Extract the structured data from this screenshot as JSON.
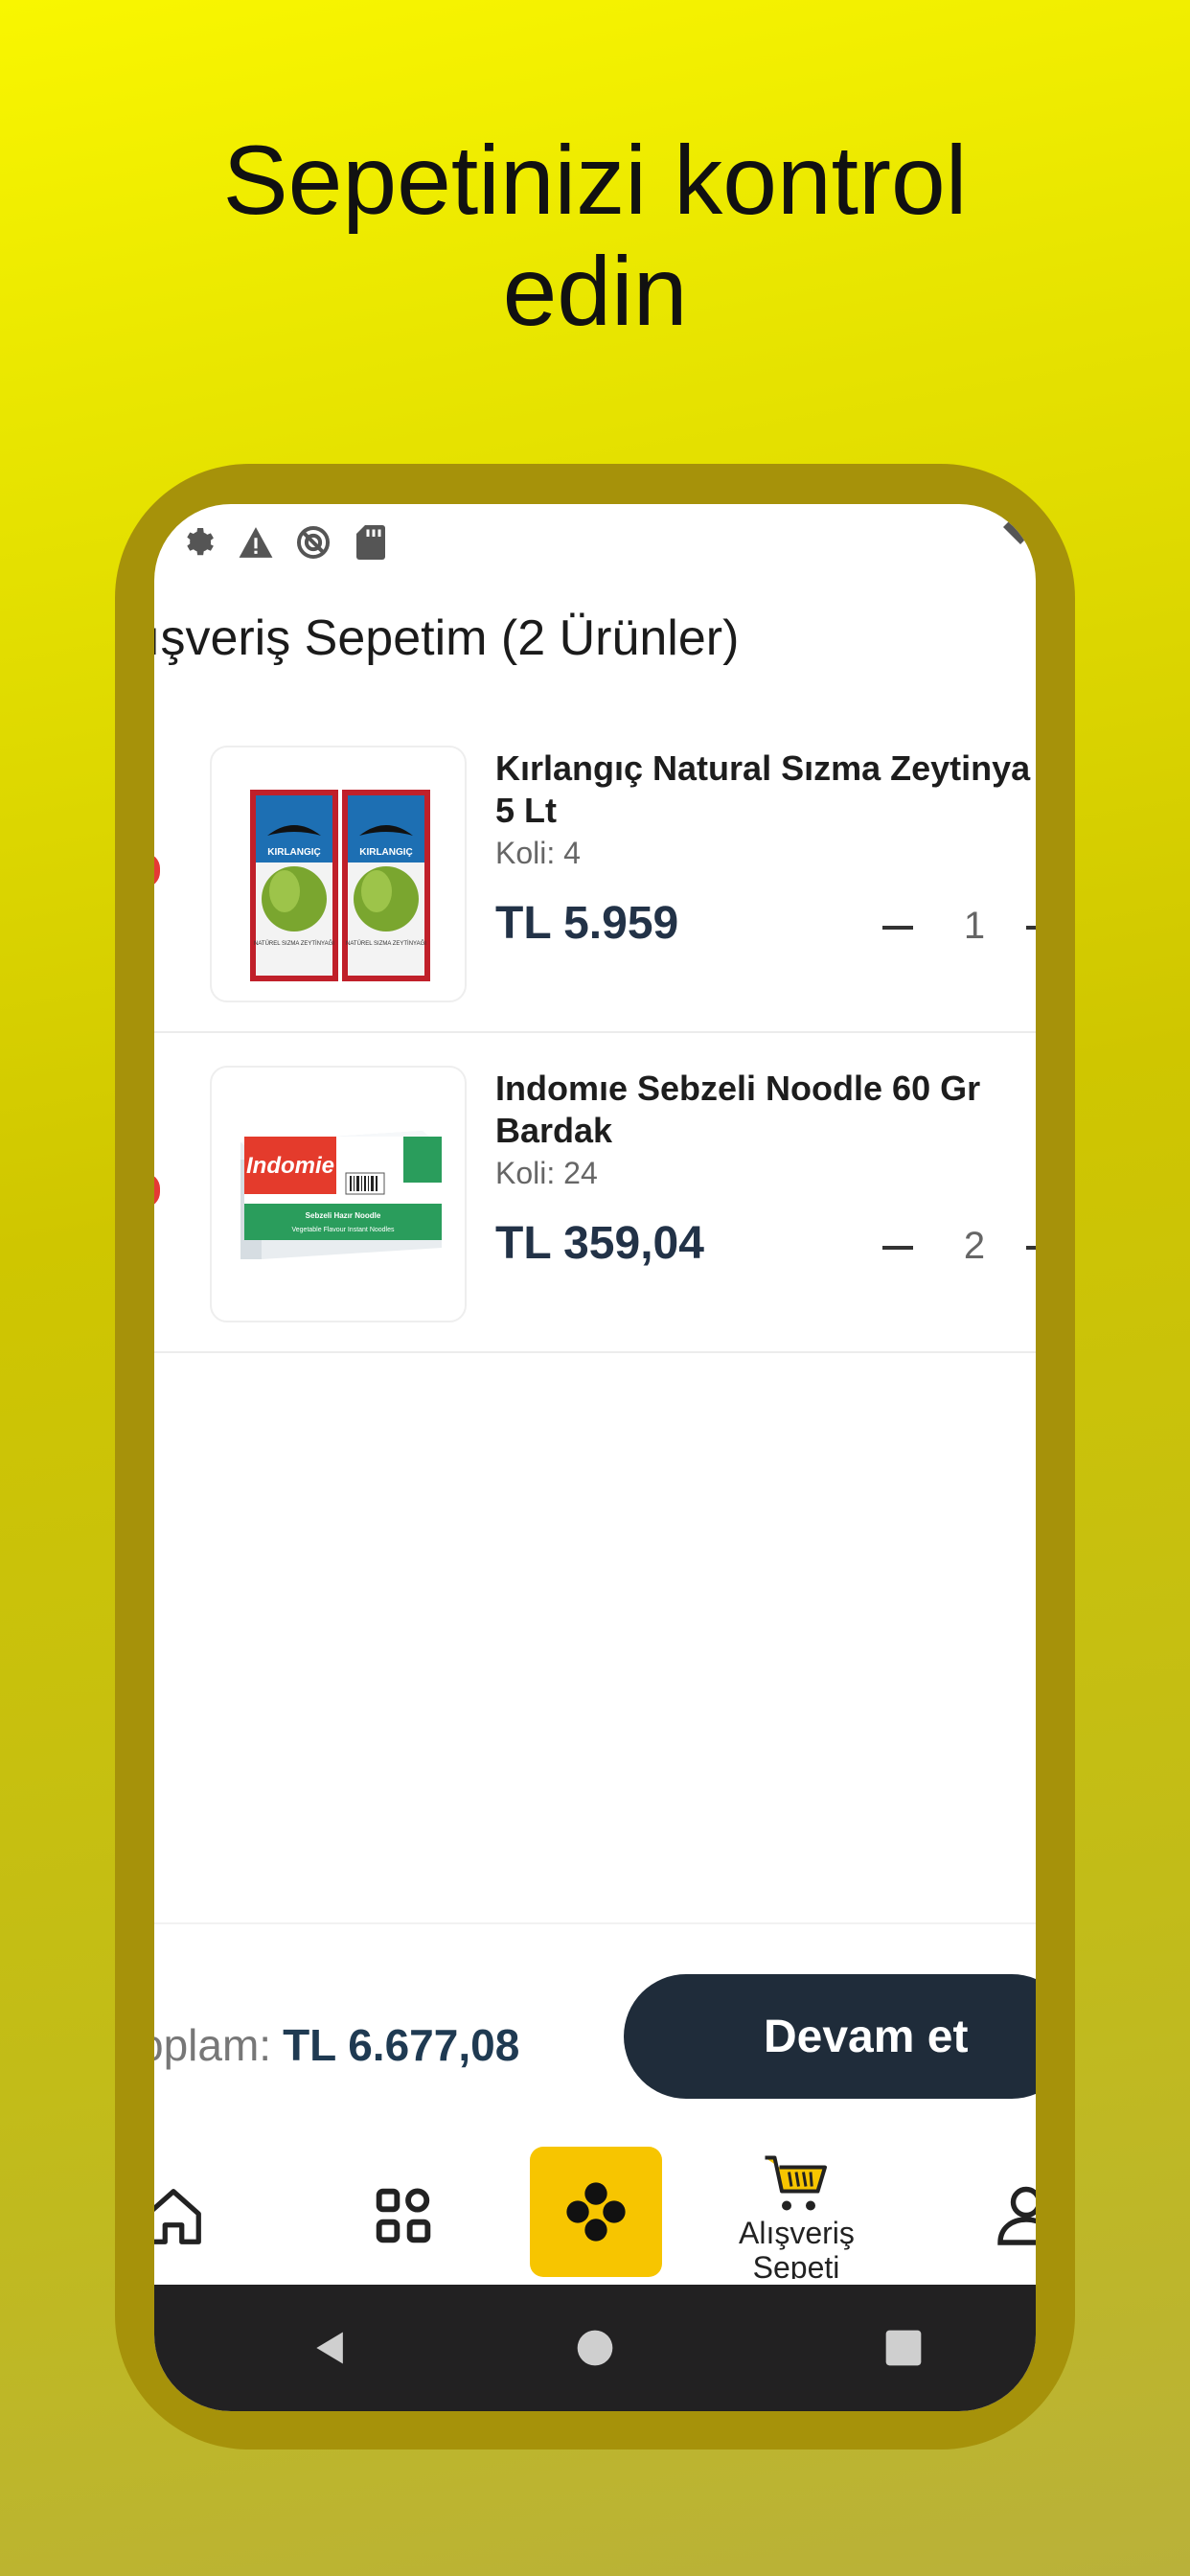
{
  "promo": {
    "headline_line1": "Sepetinizi kontrol",
    "headline_line2": "edin"
  },
  "status_bar": {
    "icons": [
      "settings-icon",
      "warning-icon",
      "data-saver-icon",
      "sd-card-icon"
    ]
  },
  "cart": {
    "title": "ışveriş Sepetim (2 Ürünler)",
    "items": [
      {
        "name": "Kırlangıç Natural Sızma Zeytinya\n5 Lt",
        "pack": "Koli: 4",
        "price": "TL 5.959",
        "quantity": "1",
        "image": "olive-oil-package",
        "image_texts": [
          "KIRLANGIÇ",
          "NATÜREL SIZMA ZEYTİNYAĞI"
        ]
      },
      {
        "name": "Indomıe Sebzeli Noodle 60 Gr\nBardak",
        "pack": "Koli: 24",
        "price": "TL 359,04",
        "quantity": "2",
        "image": "noodle-box",
        "image_texts": [
          "Indomie",
          "Sebzeli Hazır Noodle",
          "Vegetable Flavour Instant Noodles"
        ]
      }
    ]
  },
  "footer": {
    "total_label": "oplam:",
    "total_value": "TL 6.677,08",
    "continue_label": "Devam et"
  },
  "bottom_nav": {
    "items": [
      {
        "icon": "home-icon",
        "label": ""
      },
      {
        "icon": "categories-icon",
        "label": ""
      },
      {
        "icon": "center-action-icon",
        "label": ""
      },
      {
        "icon": "shopping-cart-icon",
        "label": "Alışveriş Sepeti"
      },
      {
        "icon": "profile-icon",
        "label": ""
      }
    ]
  },
  "colors": {
    "accent_yellow": "#f7c500",
    "dark_button": "#1f2c3a",
    "price_text": "#223247"
  }
}
